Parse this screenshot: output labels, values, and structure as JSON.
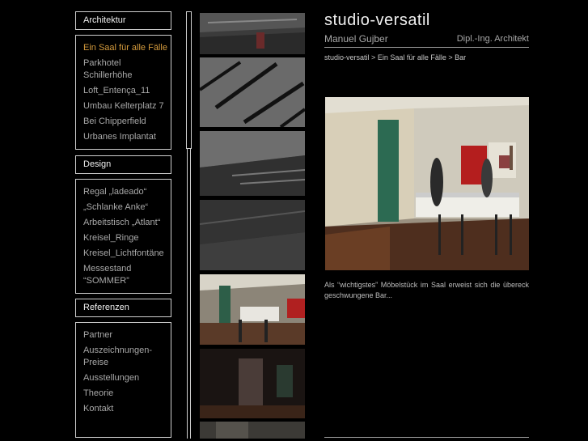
{
  "sections": {
    "architektur": {
      "label": "Architektur",
      "items": [
        "Ein Saal für alle Fälle",
        "Parkhotel Schillerhöhe",
        "Loft_Entença_11",
        "Umbau Kelterplatz 7",
        "Bei Chipperfield",
        "Urbanes Implantat"
      ]
    },
    "design": {
      "label": "Design",
      "items": [
        "Regal „ladeado“",
        "„Schlanke Anke“",
        "Arbeitstisch „Atlant“",
        "Kreisel_Ringe",
        "Kreisel_Lichtfontäne",
        "Messestand “SOMMER”"
      ]
    },
    "referenzen": {
      "label": "Referenzen",
      "items": [
        "Partner",
        "Auszeichnungen-Preise",
        "Ausstellungen",
        "Theorie",
        "Kontakt"
      ]
    }
  },
  "site": {
    "title": "studio-versatil",
    "author": "Manuel Gujber",
    "role": "Dipl.-Ing. Architekt"
  },
  "breadcrumb": {
    "root": "studio-versatil",
    "section": "Ein Saal für alle Fälle",
    "current": "Bar",
    "sep": ">"
  },
  "caption": "Als “wichtigstes” Möbelstück im Saal erweist sich die übereck geschwungene Bar...",
  "colors": {
    "accent": "#d49a3c",
    "background": "#000000",
    "border": "#cfcfcf"
  },
  "thumbnails": [
    "thumb-ceiling-1",
    "thumb-ceiling-2",
    "thumb-ceiling-3",
    "thumb-ceiling-4",
    "thumb-bar",
    "thumb-dark-room",
    "thumb-partial"
  ]
}
